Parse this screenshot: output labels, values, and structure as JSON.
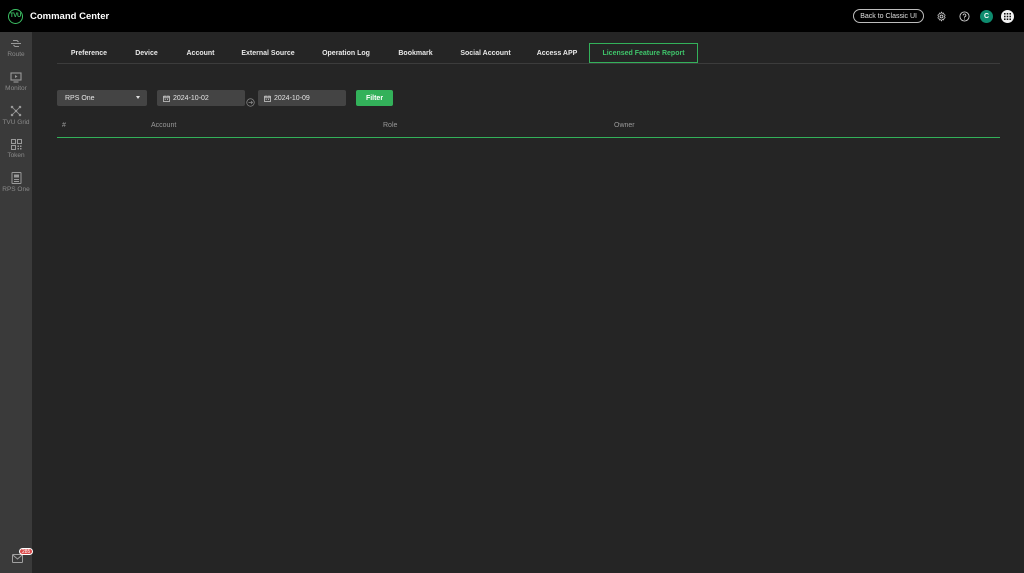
{
  "app": {
    "title": "Command Center",
    "logo_text": "TVU"
  },
  "header": {
    "classic_button": "Back to Classic UI",
    "avatar_letter": "C"
  },
  "sidebar": {
    "items": [
      {
        "label": "Route",
        "icon": "route-icon"
      },
      {
        "label": "Monitor",
        "icon": "monitor-icon"
      },
      {
        "label": "TVU Grid",
        "icon": "grid-network-icon"
      },
      {
        "label": "Token",
        "icon": "qr-token-icon"
      },
      {
        "label": "RPS One",
        "icon": "rps-one-icon"
      }
    ],
    "mail_badge": "285"
  },
  "tabs": [
    {
      "label": "Preference",
      "width": 64
    },
    {
      "label": "Device",
      "width": 51
    },
    {
      "label": "Account",
      "width": 57
    },
    {
      "label": "External Source",
      "width": 78
    },
    {
      "label": "Operation Log",
      "width": 78
    },
    {
      "label": "Bookmark",
      "width": 61
    },
    {
      "label": "Social Account",
      "width": 79
    },
    {
      "label": "Access APP",
      "width": 64
    },
    {
      "label": "Licensed Feature Report",
      "width": 109,
      "active": true
    }
  ],
  "filters": {
    "product_select": "RPS One",
    "start_date": "2024-10-02",
    "end_date": "2024-10-09",
    "filter_button": "Filter"
  },
  "table": {
    "columns": [
      "#",
      "Account",
      "Role",
      "Owner"
    ]
  },
  "colors": {
    "accent": "#33b15a",
    "topbar": "#000000",
    "background": "#252525",
    "sidebar": "#3a3a3a"
  }
}
